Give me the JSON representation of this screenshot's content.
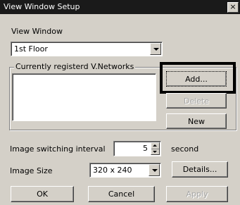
{
  "window": {
    "title": "View Window Setup",
    "close_label": "×"
  },
  "view_window": {
    "label": "View Window",
    "selected": "1st Floor"
  },
  "networks_group": {
    "label": "Currently registerd V.Networks",
    "items": []
  },
  "buttons": {
    "add": "Add...",
    "delete": "Delete",
    "new": "New",
    "details": "Details...",
    "ok": "OK",
    "cancel": "Cancel",
    "apply": "Apply"
  },
  "interval": {
    "label": "Image switching interval",
    "value": "5",
    "unit": "second"
  },
  "image_size": {
    "label": "Image Size",
    "selected": "320 x 240"
  }
}
